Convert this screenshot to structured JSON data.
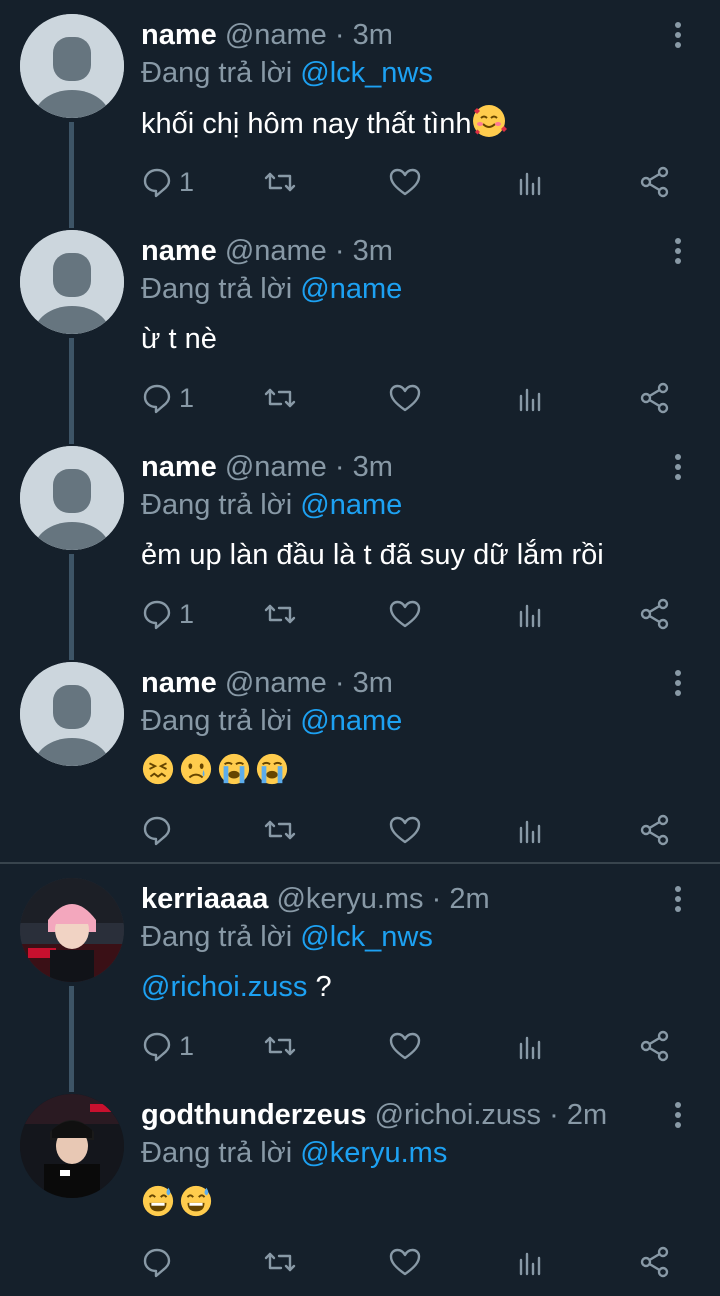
{
  "colors": {
    "background": "#15202b",
    "text": "#ffffff",
    "secondary": "#8899a6",
    "link": "#1da1f2",
    "thread_line": "#3d5466"
  },
  "tweets": [
    {
      "name": "name",
      "handle": "@name",
      "time": "3m",
      "replying_prefix": "Đang trả lời",
      "replying_to": "@lck_nws",
      "text": "khối chị hôm nay thất tình",
      "emoji": [
        "smiling-face-with-hearts"
      ],
      "reply_count": "1"
    },
    {
      "name": "name",
      "handle": "@name",
      "time": "3m",
      "replying_prefix": "Đang trả lời",
      "replying_to": "@name",
      "text": "ừ t nè",
      "reply_count": "1"
    },
    {
      "name": "name",
      "handle": "@name",
      "time": "3m",
      "replying_prefix": "Đang trả lời",
      "replying_to": "@name",
      "text": "ẻm up làn đầu là t đã suy dữ lắm rồi",
      "reply_count": "1"
    },
    {
      "name": "name",
      "handle": "@name",
      "time": "3m",
      "replying_prefix": "Đang trả lời",
      "replying_to": "@name",
      "text": "",
      "emoji": [
        "confounded-face",
        "crying-face",
        "loudly-crying-face",
        "loudly-crying-face"
      ],
      "reply_count": ""
    },
    {
      "name": "kerriaaaa",
      "handle": "@keryu.ms",
      "time": "2m",
      "replying_prefix": "Đang trả lời",
      "replying_to": "@lck_nws",
      "text_mention": "@richoi.zuss",
      "text": " ?",
      "reply_count": "1"
    },
    {
      "name": "godthunderzeus",
      "handle": "@richoi.zuss",
      "time": "2m",
      "replying_prefix": "Đang trả lời",
      "replying_to": "@keryu.ms",
      "text": "",
      "emoji": [
        "grinning-face-with-sweat",
        "grinning-face-with-sweat"
      ],
      "reply_count": ""
    }
  ],
  "separator": "·"
}
